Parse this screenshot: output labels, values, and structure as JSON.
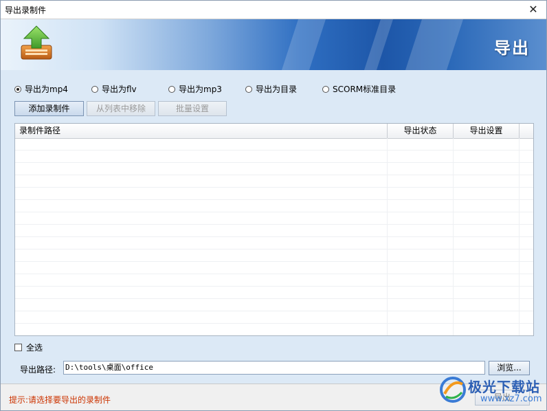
{
  "window": {
    "title": "导出录制件",
    "close_glyph": "✕"
  },
  "banner": {
    "title": "导出",
    "icon": "export-upload-icon"
  },
  "export_options": [
    {
      "label": "导出为mp4",
      "checked": true
    },
    {
      "label": "导出为flv",
      "checked": false
    },
    {
      "label": "导出为mp3",
      "checked": false
    },
    {
      "label": "导出为目录",
      "checked": false
    },
    {
      "label": "SCORM标准目录",
      "checked": false
    }
  ],
  "toolbar": {
    "add_label": "添加录制件",
    "remove_label": "从列表中移除",
    "batch_label": "批量设置"
  },
  "table": {
    "columns": [
      "录制件路径",
      "导出状态",
      "导出设置"
    ],
    "rows": []
  },
  "select_all": {
    "label": "全选",
    "checked": false
  },
  "export_path": {
    "label": "导出路径:",
    "value": "D:\\tools\\桌面\\office",
    "browse_label": "浏览..."
  },
  "footer": {
    "hint": "提示:请选择要导出的录制件",
    "export_label": "导出"
  },
  "watermark": {
    "text": "极光下载站",
    "sub": "www.xz7.com"
  }
}
